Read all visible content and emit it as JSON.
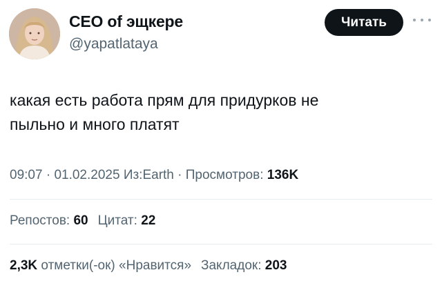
{
  "author": {
    "display_name": "CEO of эщкере",
    "handle": "@yapatlataya"
  },
  "actions": {
    "follow_label": "Читать",
    "more_icon": "more-horizontal-icon"
  },
  "tweet": {
    "lines": [
      "какая есть работа прям для придурков не",
      "пыльно и много платят"
    ]
  },
  "meta": {
    "time": "09:07",
    "separator": " · ",
    "date": "01.02.2025",
    "source": "Из:Earth",
    "views_label": "Просмотров:",
    "views_value": "136K"
  },
  "stats_row1": {
    "reposts_label": "Репостов:",
    "reposts_value": "60",
    "quotes_label": "Цитат:",
    "quotes_value": "22"
  },
  "stats_row2": {
    "likes_value": "2,3K",
    "likes_label": "отметки(-ок) «Нравится»",
    "bookmarks_label": "Закладок:",
    "bookmarks_value": "203"
  },
  "colors": {
    "text": "#0f1419",
    "secondary": "#536471",
    "divider": "#e6ecf0",
    "button_bg": "#0f1419"
  }
}
